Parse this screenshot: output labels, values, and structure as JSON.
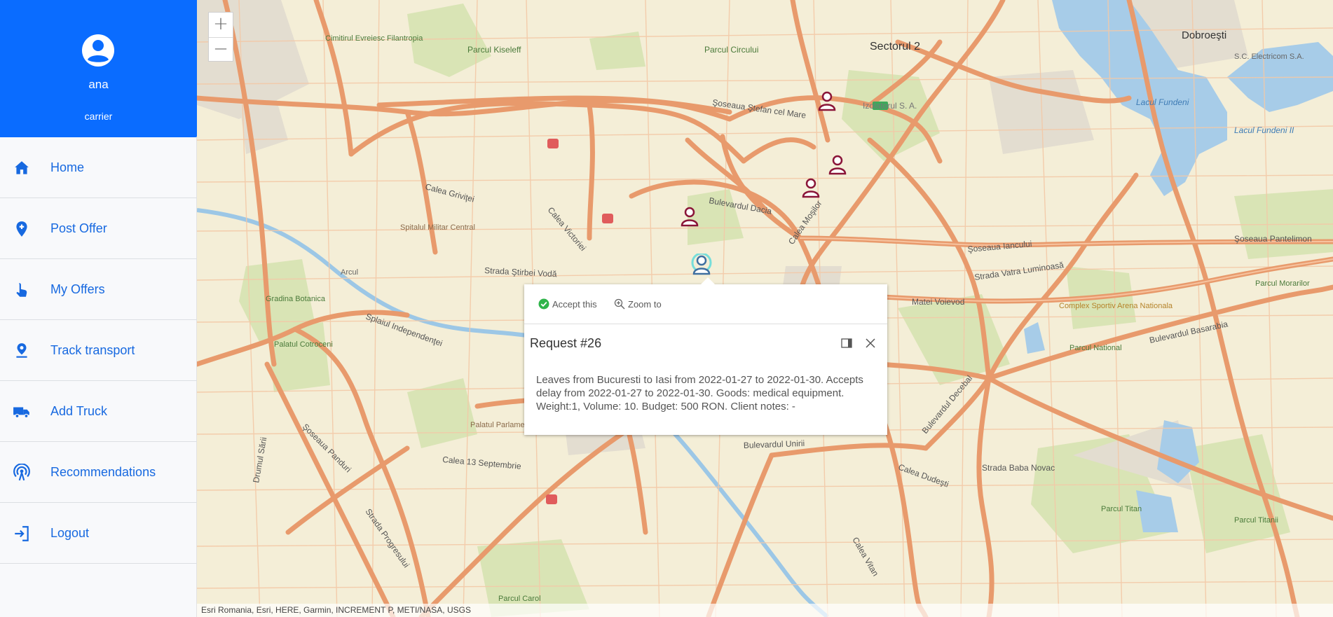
{
  "user": {
    "name": "ana",
    "role": "carrier"
  },
  "nav": [
    {
      "label": "Home",
      "icon": "home-icon"
    },
    {
      "label": "Post Offer",
      "icon": "add-location-icon"
    },
    {
      "label": "My Offers",
      "icon": "touch-hand-icon"
    },
    {
      "label": "Track transport",
      "icon": "location-pin-icon"
    },
    {
      "label": "Add Truck",
      "icon": "truck-icon"
    },
    {
      "label": "Recommendations",
      "icon": "broadcast-icon"
    },
    {
      "label": "Logout",
      "icon": "logout-icon"
    }
  ],
  "map": {
    "zoom_in_label": "+",
    "zoom_out_label": "−",
    "attribution": "Esri Romania, Esri, HERE, Garmin, INCREMENT P, METI/NASA, USGS",
    "labels": {
      "sectorul2": "Sectorul 2",
      "dobroesti": "Dobroeşti",
      "parcul_kiseleff": "Parcul Kiseleff",
      "parcul_circului": "Parcul Circului",
      "cimitirul_evreiesc": "Cimitirul Evreiesc Filantropia",
      "izolatorul": "Izolatorul S. A.",
      "lacul_fundeni": "Lacul Fundeni",
      "lacul_fundeni_ii": "Lacul Fundeni II",
      "sc_electricom": "S.C. Electricom S.A.",
      "soseaua_stefan": "Şoseaua Ştefan cel Mare",
      "soseaua_iancului": "Şoseaua Iancului",
      "soseaua_pantelimon": "Şoseaua Pantelimon",
      "bulevardul_dacia": "Bulevardul Dacia",
      "calea_grivitei": "Calea Griviţei",
      "spitalul_militar": "Spitalul Militar Central",
      "gradina_botanica": "Gradina Botanica",
      "palatul_cotroceni": "Palatul Cotroceni",
      "splaiul_independentei": "Splaiul Independenţei",
      "palatul_parlamentului": "Palatul Parlamentului",
      "calea_13": "Calea 13 Septembrie",
      "bulevardul_unirii": "Bulevardul Unirii",
      "parcul_national": "Parcul National",
      "complex_sportiv": "Complex Sportiv Arena Nationala",
      "bulevardul_basarabia": "Bulevardul Basarabia",
      "parcul_titan": "Parcul Titan",
      "parcul_carol": "Parcul Carol",
      "strada_baba_novac": "Strada Baba Novac",
      "calea_dudesti": "Calea Dudeşti",
      "parcul_morarilor": "Parcul Morarilor",
      "parcul_titanii": "Parcul Titanii",
      "bulevardul_decebal": "Bulevardul Decebal",
      "strada_vatra": "Strada Vatra Luminoasă",
      "calea_mosilor": "Calea Moşilor",
      "calea_victoriei": "Calea Victoriei",
      "arcul": "Arcul",
      "drumul_sarii": "Drumul Sării",
      "strada_progresului": "Strada Progresului",
      "soseaua_panduri": "Şoseaua Panduri",
      "calea_vitan": "Calea Vitan",
      "strada_matei": "Matei Voievod",
      "strada_stirbei": "Strada Ştirbei Vodă"
    }
  },
  "popup": {
    "accept_label": "Accept this",
    "zoom_label": "Zoom to",
    "title": "Request #26",
    "body": "Leaves from Bucuresti to Iasi from 2022-01-27 to 2022-01-30. Accepts delay from 2022-01-27 to 2022-01-30. Goods: medical equipment. Weight:1, Volume: 10. Budget: 500 RON. Client notes: -"
  },
  "colors": {
    "primary": "#0a6cff",
    "nav_text": "#1769e0",
    "marker": "#8a1538",
    "selected_marker": "#00b2c2",
    "accept_check": "#2fb44a"
  }
}
